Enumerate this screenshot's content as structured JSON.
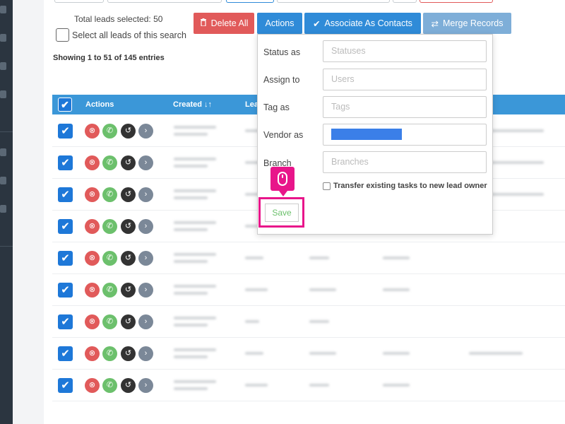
{
  "header": {
    "total_leads_label": "Total leads selected: 50",
    "select_all_label": "Select all leads of this search",
    "showing_label": "Showing 1 to 51 of 145 entries"
  },
  "toolbar": {
    "delete_all_label": "Delete All",
    "actions_label": "Actions",
    "associate_label": "Associate As Contacts",
    "merge_label": "Merge Records"
  },
  "table": {
    "col_actions": "Actions",
    "col_created": "Created ↓↑",
    "col_lead": "Lea",
    "row_count": 9
  },
  "actions_panel": {
    "status_label": "Status as",
    "status_placeholder": "Statuses",
    "assign_label": "Assign to",
    "assign_placeholder": "Users",
    "tag_label": "Tag as",
    "tag_placeholder": "Tags",
    "vendor_label": "Vendor as",
    "branch_label": "Branch",
    "branch_placeholder": "Branches",
    "transfer_label": "Transfer existing tasks to new lead owner",
    "save_label": "Save"
  },
  "colors": {
    "primary": "#2f8bd8",
    "danger": "#e15a5a",
    "success": "#6cc06c",
    "highlight": "#e8158a",
    "sidebar": "#2b3540"
  }
}
